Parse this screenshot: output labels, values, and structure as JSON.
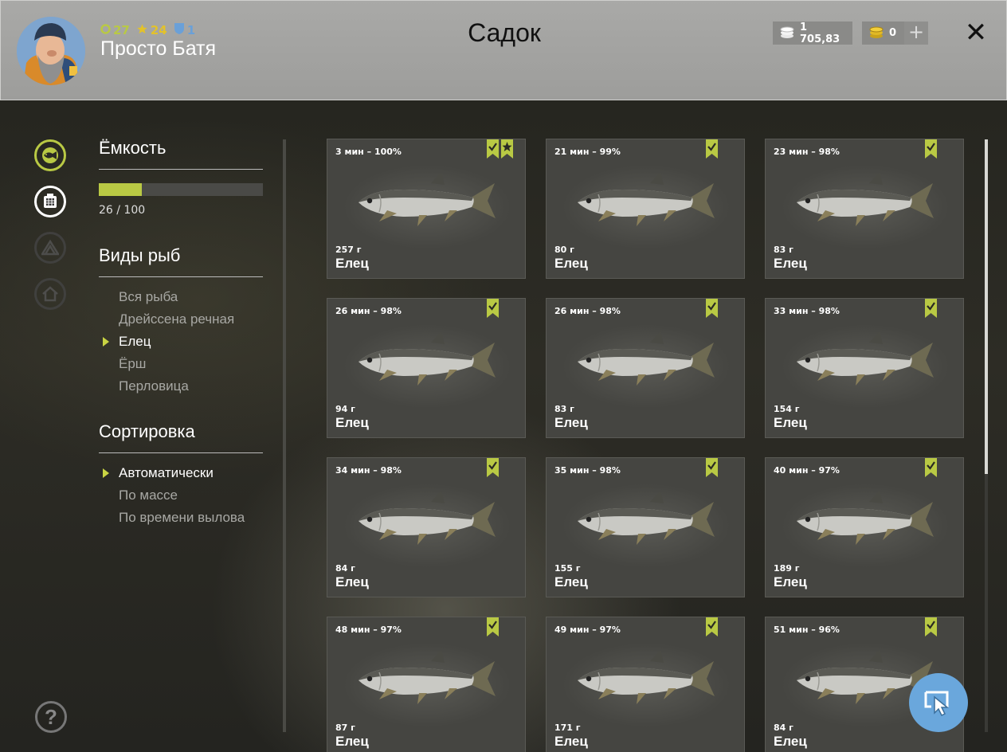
{
  "header": {
    "title": "Садок",
    "player_name": "Просто Батя",
    "level": "27",
    "stars": "24",
    "shields": "1",
    "silver": "1 705,83",
    "gold": "0"
  },
  "sidebar": {
    "capacity_title": "Ёмкость",
    "capacity_text": "26 / 100",
    "capacity_fraction": 0.26,
    "species_title": "Виды рыб",
    "species": [
      {
        "label": "Вся рыба",
        "active": false
      },
      {
        "label": "Дрейссена речная",
        "active": false
      },
      {
        "label": "Елец",
        "active": true
      },
      {
        "label": "Ёрш",
        "active": false
      },
      {
        "label": "Перловица",
        "active": false
      }
    ],
    "sort_title": "Сортировка",
    "sort": [
      {
        "label": "Автоматически",
        "active": true
      },
      {
        "label": "По массе",
        "active": false
      },
      {
        "label": "По времени вылова",
        "active": false
      }
    ]
  },
  "fish": [
    {
      "time": "3 мин – 100%",
      "weight": "257 г",
      "name": "Елец",
      "star": true
    },
    {
      "time": "21 мин – 99%",
      "weight": "80 г",
      "name": "Елец",
      "star": false
    },
    {
      "time": "23 мин – 98%",
      "weight": "83 г",
      "name": "Елец",
      "star": false
    },
    {
      "time": "26 мин – 98%",
      "weight": "94 г",
      "name": "Елец",
      "star": false
    },
    {
      "time": "26 мин – 98%",
      "weight": "83 г",
      "name": "Елец",
      "star": false
    },
    {
      "time": "33 мин – 98%",
      "weight": "154 г",
      "name": "Елец",
      "star": false
    },
    {
      "time": "34 мин – 98%",
      "weight": "84 г",
      "name": "Елец",
      "star": false
    },
    {
      "time": "35 мин – 98%",
      "weight": "155 г",
      "name": "Елец",
      "star": false
    },
    {
      "time": "40 мин – 97%",
      "weight": "189 г",
      "name": "Елец",
      "star": false
    },
    {
      "time": "48 мин – 97%",
      "weight": "87 г",
      "name": "Елец",
      "star": false
    },
    {
      "time": "49 мин – 97%",
      "weight": "171 г",
      "name": "Елец",
      "star": false
    },
    {
      "time": "51 мин – 96%",
      "weight": "84 г",
      "name": "Елец",
      "star": false
    }
  ],
  "icons": {
    "level": "ring-icon",
    "star": "star-icon",
    "shield": "shield-icon",
    "silver": "silver-coins-icon",
    "gold": "gold-coins-icon",
    "add": "plus-icon",
    "close": "close-icon",
    "help": "question-icon",
    "cursor": "cursor-icon"
  },
  "colors": {
    "accent": "#b9c944",
    "cursor_button": "#6aa7dc"
  }
}
